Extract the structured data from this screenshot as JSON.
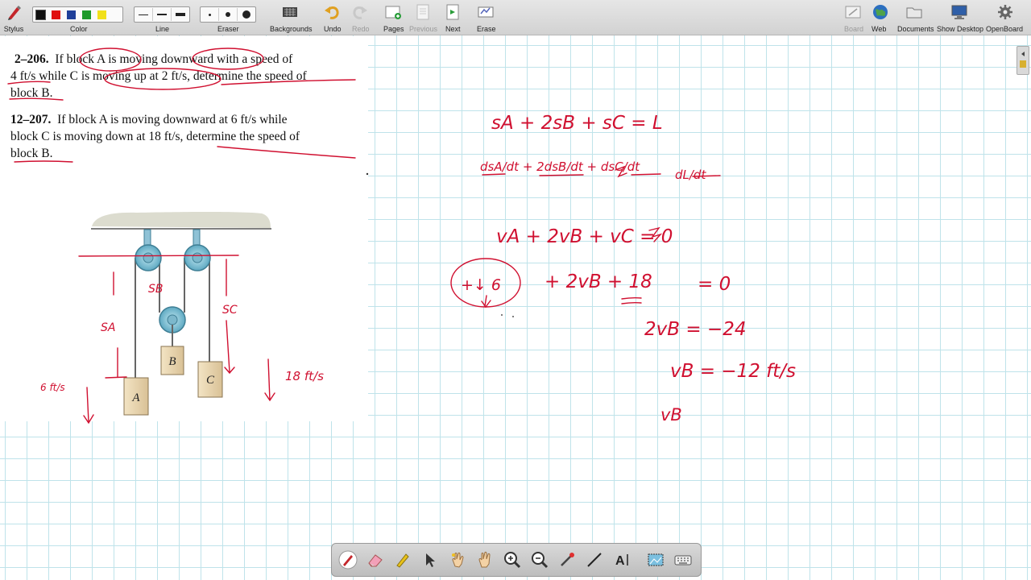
{
  "toolbar": {
    "stylus": "Stylus",
    "color": "Color",
    "line": "Line",
    "eraser": "Eraser",
    "backgrounds": "Backgrounds",
    "undo": "Undo",
    "redo": "Redo",
    "pages": "Pages",
    "previous": "Previous",
    "next": "Next",
    "erase": "Erase",
    "board": "Board",
    "web": "Web",
    "documents": "Documents",
    "show_desktop": "Show Desktop",
    "openboard": "OpenBoard"
  },
  "colors": {
    "swatches": [
      "#111111",
      "#e01010",
      "#1f3f99",
      "#1d9a2a",
      "#f1e01a"
    ],
    "ink": "#d01030",
    "grid": "#bfe3ea"
  },
  "problem": {
    "p206_num": "2–206.",
    "p206_line1": "If block A is moving downward with a speed of",
    "p206_line2": "4 ft/s while C is moving up at 2 ft/s, determine the speed of",
    "p206_line3": "block B.",
    "p207_num": "12–207.",
    "p207_line1": "If block A is moving downward at 6 ft/s while",
    "p207_line2": "block C is moving down at 18 ft/s, determine the speed of",
    "p207_line3": "block B.",
    "label_a": "A",
    "label_b": "B",
    "label_c": "C"
  },
  "handwriting": {
    "eq1": "sA + 2sB + sC = L",
    "eq2_lhs": "dsA/dt + 2dsB/dt + dsC/dt",
    "eq2_rhs": "dL/dt",
    "eq3": "vA + 2vB + vC = 0",
    "eq4_circle": "+↓ 6",
    "eq4_rest": "+ 2vB + 18",
    "eq4_rhs": "= 0",
    "eq5": "2vB = −24",
    "eq6": "vB = −12 ft/s",
    "eq7": "vB",
    "diag_sa": "SA",
    "diag_sb": "SB",
    "diag_sc": "SC",
    "diag_va": "6 ft/s",
    "diag_vc": "18 ft/s"
  }
}
